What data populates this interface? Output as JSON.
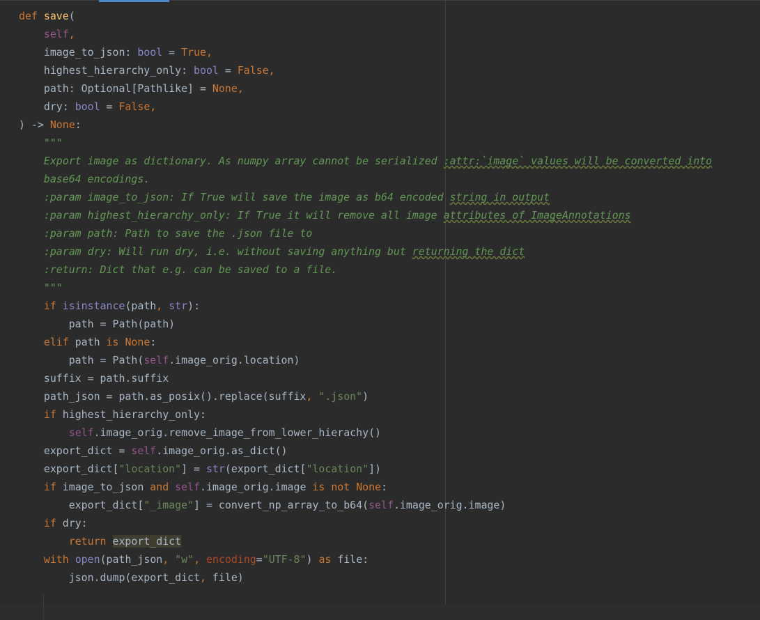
{
  "editor": {
    "language": "python",
    "code_lines": [
      "def save(",
      "    self,",
      "    image_to_json: bool = True,",
      "    highest_hierarchy_only: bool = False,",
      "    path: Optional[Pathlike] = None,",
      "    dry: bool = False,",
      ") -> None:",
      "    \"\"\"",
      "    Export image as dictionary. As numpy array cannot be serialized :attr:`image` values will be converted into",
      "    base64 encodings.",
      "    :param image_to_json: If True will save the image as b64 encoded string in output",
      "    :param highest_hierarchy_only: If True it will remove all image attributes of ImageAnnotations",
      "    :param path: Path to save the .json file to",
      "    :param dry: Will run dry, i.e. without saving anything but returning the dict",
      "    :return: Dict that e.g. can be saved to a file.",
      "    \"\"\"",
      "    if isinstance(path, str):",
      "        path = Path(path)",
      "    elif path is None:",
      "        path = Path(self.image_orig.location)",
      "    suffix = path.suffix",
      "    path_json = path.as_posix().replace(suffix, \".json\")",
      "    if highest_hierarchy_only:",
      "        self.image_orig.remove_image_from_lower_hierachy()",
      "    export_dict = self.image_orig.as_dict()",
      "    export_dict[\"location\"] = str(export_dict[\"location\"])",
      "    if image_to_json and self.image_orig.image is not None:",
      "        export_dict[\"_image\"] = convert_np_array_to_b64(self.image_orig.image)",
      "    if dry:",
      "        return export_dict",
      "    with open(path_json, \"w\", encoding=\"UTF-8\") as file:",
      "        json.dump(export_dict, file)"
    ],
    "colors": {
      "background": "#2b2b2b",
      "default_text": "#a9b7c6",
      "keyword": "#cc7832",
      "self": "#94558d",
      "builtin": "#8888c6",
      "function_name": "#ffc66d",
      "string": "#6a8759",
      "docstring": "#629755",
      "highlight": "#3e3d2f",
      "tab_indicator": "#4a88c7"
    }
  }
}
